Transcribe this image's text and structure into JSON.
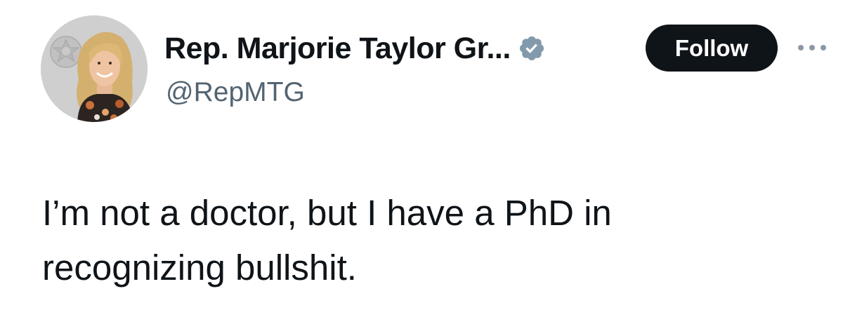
{
  "author": {
    "display_name": "Rep. Marjorie Taylor Gr...",
    "handle": "@RepMTG",
    "verified": true,
    "verified_badge_color": "#829aab"
  },
  "actions": {
    "follow_label": "Follow",
    "more_icon": "more-dots-icon"
  },
  "tweet": {
    "text_lines": [
      "I’m not a doctor, but I have a PhD in",
      "recognizing bullshit."
    ]
  },
  "colors": {
    "text_primary": "#0f1419",
    "text_secondary": "#536471",
    "button_bg": "#0f1419",
    "button_text": "#ffffff"
  }
}
